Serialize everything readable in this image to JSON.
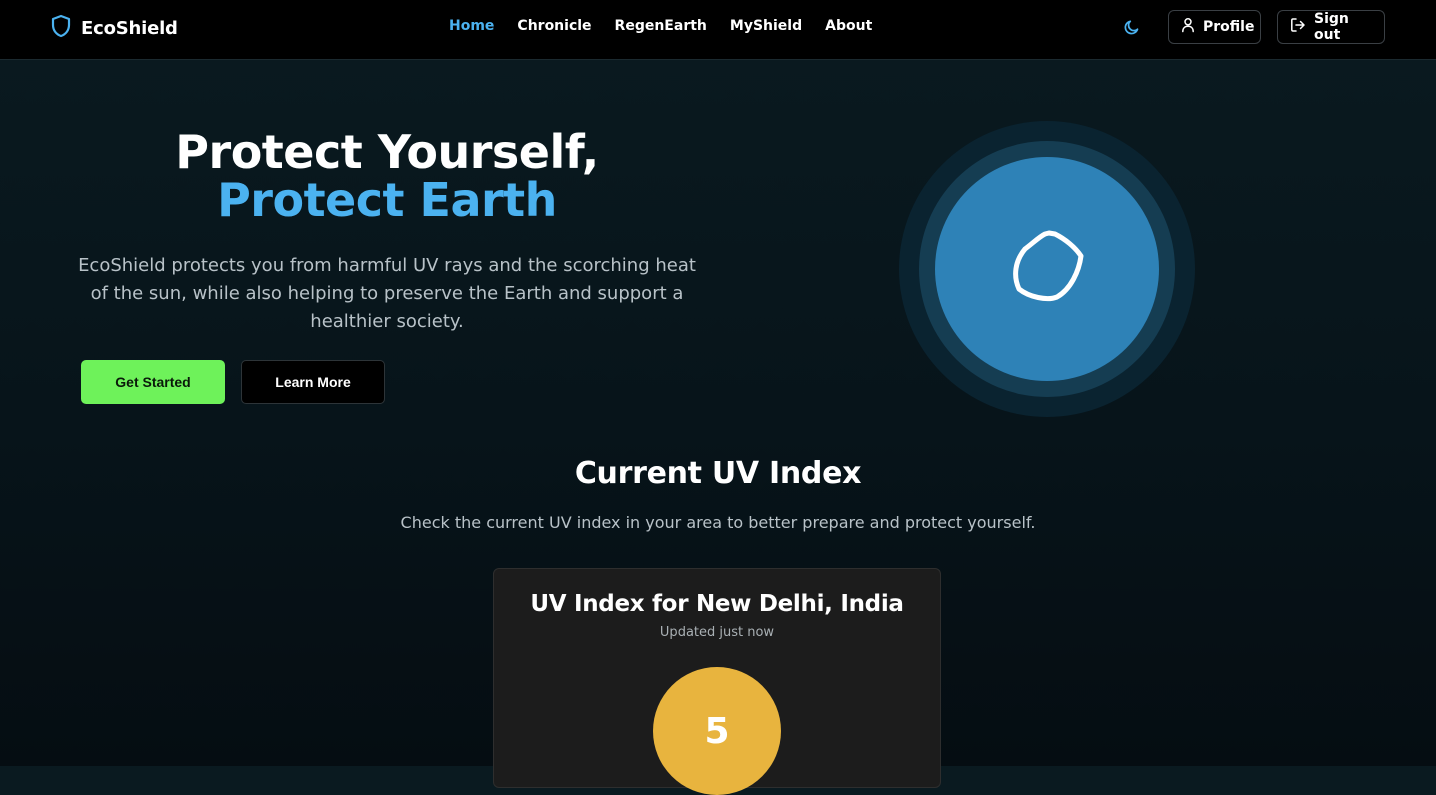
{
  "brand": {
    "name": "EcoShield",
    "accent": "#4bb2f0"
  },
  "nav": {
    "links": [
      {
        "label": "Home",
        "active": true
      },
      {
        "label": "Chronicle"
      },
      {
        "label": "RegenEarth"
      },
      {
        "label": "MyShield"
      },
      {
        "label": "About"
      }
    ],
    "theme_icon": "moon-icon",
    "profile_label": "Profile",
    "signout_label": "Sign out"
  },
  "hero": {
    "title_line1": "Protect Yourself,",
    "title_line2": "Protect Earth",
    "description": "EcoShield protects you from harmful UV rays and the scorching heat of the sun, while also helping to preserve the Earth and support a healthier society.",
    "primary_button": "Get Started",
    "secondary_button": "Learn More",
    "primary_color": "#6ef25a",
    "emblem_icon": "shield-icon"
  },
  "uv_section": {
    "heading": "Current UV Index",
    "subheading": "Check the current UV index in your area to better prepare and protect yourself.",
    "card_title": "UV Index for New Delhi, India",
    "updated": "Updated just now",
    "value": "5",
    "value_color": "#e8b43e"
  }
}
